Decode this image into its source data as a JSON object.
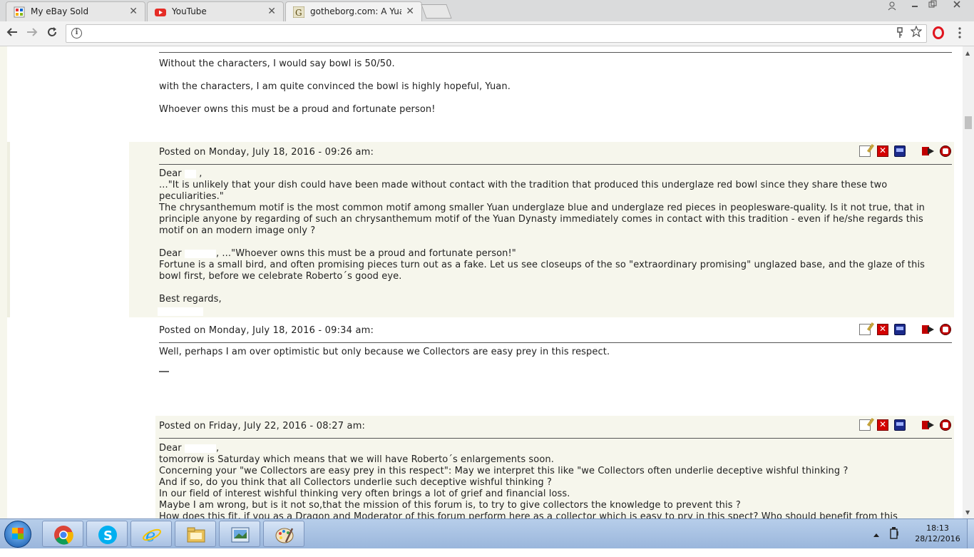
{
  "browser": {
    "tabs": [
      {
        "title": "My eBay Sold",
        "icon": "ebay-icon",
        "active": false
      },
      {
        "title": "YouTube",
        "icon": "youtube-icon",
        "active": false
      },
      {
        "title": "gotheborg.com: A Yuan F",
        "icon": "gotheborg-icon",
        "active": true
      }
    ],
    "address": "",
    "info_glyph": "i"
  },
  "posts": {
    "top": {
      "lines": [
        "Without the characters, I would say bowl is 50/50.",
        "with the characters, I am quite convinced the bowl is highly hopeful, Yuan.",
        "Whoever owns this must be a proud and fortunate person!"
      ]
    },
    "post1": {
      "header": "Posted on Monday, July 18, 2016 - 09:26 am:",
      "dear1": "Dear",
      "dear1_end": ",",
      "lines": [
        "...\"It is unlikely that your dish could have been made without contact with the tradition that produced this underglaze red bowl since they share these two",
        "peculiarities.\"",
        "The chrysanthemum motif is the most common motif among smaller Yuan underglaze blue and underglaze red pieces in peoplesware-quality. Is it not true, that in",
        "principle anyone by regarding of such an chrysanthemum motif of the Yuan Dynasty immediately comes in contact with this tradition - even if he/she regards this",
        "motif on an modern image only ?"
      ],
      "dear2": "Dear",
      "dear2_end": ", ...\"Whoever owns this must be a proud and fortunate person!\"",
      "lines2": [
        "Fortune is a small bird, and often promising pieces turn out as a fake. Let us see closeups of the so \"extraordinary promising\" unglazed base, and the glaze of this",
        "bowl first, before we celebrate Roberto´s good eye."
      ],
      "closing": "Best regards,"
    },
    "post2": {
      "header": "Posted on Monday, July 18, 2016 - 09:34 am:",
      "line": "Well, perhaps I am over optimistic but only because we Collectors are easy prey in this respect."
    },
    "post3": {
      "header": "Posted on Friday, July 22, 2016 - 08:27 am:",
      "dear": "Dear",
      "dear_end": ",",
      "lines": [
        "tomorrow is Saturday which means that we will have Roberto´s enlargements soon.",
        "Concerning your \"we Collectors are easy prey in this respect\": May we interpret this like \"we Collectors often underlie deceptive wishful thinking ?",
        "And if so, do you think that all Collectors underlie such deceptive wishful thinking ?",
        "In our field of interest wishful thinking very often brings a lot of grief and financial loss.",
        "Maybe I am wrong, but is it not so,that the mission of this forum is, to try to give collectors the knowledge to prevent this ?",
        "How does this fit, if you as a Dragon and Moderator of this forum perform here as a collector which is easy to pry in this spect? Who should benefit from this"
      ]
    }
  },
  "post_icons": [
    "edit-icon",
    "delete-icon",
    "ip-icon",
    "move-icon",
    "report-icon"
  ],
  "taskbar": {
    "time": "18:13",
    "date": "28/12/2016",
    "apps": [
      "chrome-icon",
      "skype-icon",
      "ie-icon",
      "explorer-icon",
      "photo-viewer-icon",
      "paint-icon"
    ]
  },
  "colors": {
    "post_bg": "#f6f6ec",
    "taskbar": "#a9c1e3",
    "delete_red": "#d40000"
  }
}
